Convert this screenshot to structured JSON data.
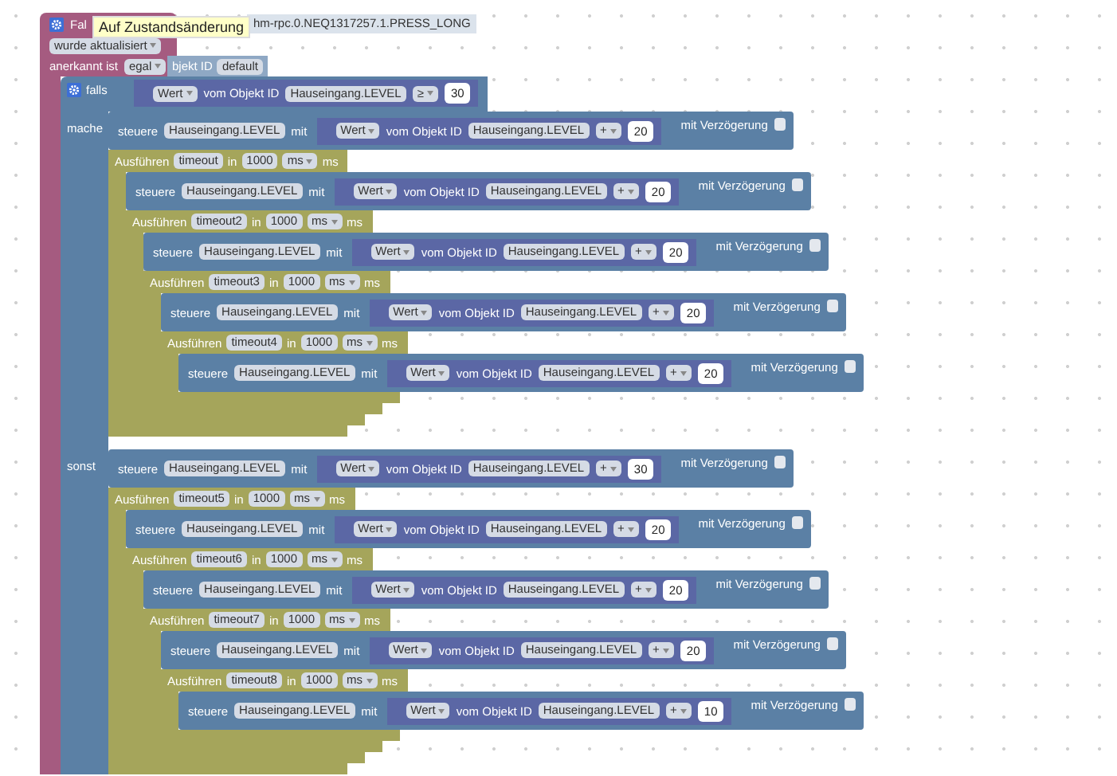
{
  "trigger": {
    "title": "Fal",
    "tooltip": "Auf Zustandsänderung",
    "object_id": "hm-rpc.0.NEQ1317257.1.PRESS_LONG",
    "mode": "wurde aktualisiert",
    "ack_label": "anerkannt ist",
    "ack_value": "egal",
    "object_label": "bjekt ID",
    "object_value": "default"
  },
  "if_block": {
    "if_label": "falls",
    "condition": {
      "select": "Wert",
      "of_label": "vom Objekt ID",
      "object_id": "Hauseingang.LEVEL",
      "operator": "≥",
      "number": "30"
    },
    "then_label": "mache",
    "then": [
      {
        "kind": "set",
        "verb": "steuere",
        "target": "Hauseingang.LEVEL",
        "with": "mit",
        "value": {
          "select": "Wert",
          "of_label": "vom Objekt ID",
          "object_id": "Hauseingang.LEVEL",
          "operator": "+",
          "number": "20"
        },
        "delay_label": "mit Verzögerung",
        "delay": false
      },
      {
        "kind": "timeout",
        "label": "Ausführen",
        "name": "timeout",
        "in": "in",
        "duration": "1000",
        "unit": "ms",
        "suffix": "ms",
        "children": [
          {
            "kind": "set",
            "verb": "steuere",
            "target": "Hauseingang.LEVEL",
            "with": "mit",
            "value": {
              "select": "Wert",
              "of_label": "vom Objekt ID",
              "object_id": "Hauseingang.LEVEL",
              "operator": "+",
              "number": "20"
            },
            "delay_label": "mit Verzögerung",
            "delay": false
          },
          {
            "kind": "timeout",
            "label": "Ausführen",
            "name": "timeout2",
            "in": "in",
            "duration": "1000",
            "unit": "ms",
            "suffix": "ms",
            "children": [
              {
                "kind": "set",
                "verb": "steuere",
                "target": "Hauseingang.LEVEL",
                "with": "mit",
                "value": {
                  "select": "Wert",
                  "of_label": "vom Objekt ID",
                  "object_id": "Hauseingang.LEVEL",
                  "operator": "+",
                  "number": "20"
                },
                "delay_label": "mit Verzögerung",
                "delay": false
              },
              {
                "kind": "timeout",
                "label": "Ausführen",
                "name": "timeout3",
                "in": "in",
                "duration": "1000",
                "unit": "ms",
                "suffix": "ms",
                "children": [
                  {
                    "kind": "set",
                    "verb": "steuere",
                    "target": "Hauseingang.LEVEL",
                    "with": "mit",
                    "value": {
                      "select": "Wert",
                      "of_label": "vom Objekt ID",
                      "object_id": "Hauseingang.LEVEL",
                      "operator": "+",
                      "number": "20"
                    },
                    "delay_label": "mit Verzögerung",
                    "delay": false
                  },
                  {
                    "kind": "timeout",
                    "label": "Ausführen",
                    "name": "timeout4",
                    "in": "in",
                    "duration": "1000",
                    "unit": "ms",
                    "suffix": "ms",
                    "children": [
                      {
                        "kind": "set",
                        "verb": "steuere",
                        "target": "Hauseingang.LEVEL",
                        "with": "mit",
                        "value": {
                          "select": "Wert",
                          "of_label": "vom Objekt ID",
                          "object_id": "Hauseingang.LEVEL",
                          "operator": "+",
                          "number": "20"
                        },
                        "delay_label": "mit Verzögerung",
                        "delay": false
                      }
                    ]
                  }
                ]
              }
            ]
          }
        ]
      }
    ],
    "else_label": "sonst",
    "else": [
      {
        "kind": "set",
        "verb": "steuere",
        "target": "Hauseingang.LEVEL",
        "with": "mit",
        "value": {
          "select": "Wert",
          "of_label": "vom Objekt ID",
          "object_id": "Hauseingang.LEVEL",
          "operator": "+",
          "number": "30"
        },
        "delay_label": "mit Verzögerung",
        "delay": false
      },
      {
        "kind": "timeout",
        "label": "Ausführen",
        "name": "timeout5",
        "in": "in",
        "duration": "1000",
        "unit": "ms",
        "suffix": "ms",
        "children": [
          {
            "kind": "set",
            "verb": "steuere",
            "target": "Hauseingang.LEVEL",
            "with": "mit",
            "value": {
              "select": "Wert",
              "of_label": "vom Objekt ID",
              "object_id": "Hauseingang.LEVEL",
              "operator": "+",
              "number": "20"
            },
            "delay_label": "mit Verzögerung",
            "delay": false
          },
          {
            "kind": "timeout",
            "label": "Ausführen",
            "name": "timeout6",
            "in": "in",
            "duration": "1000",
            "unit": "ms",
            "suffix": "ms",
            "children": [
              {
                "kind": "set",
                "verb": "steuere",
                "target": "Hauseingang.LEVEL",
                "with": "mit",
                "value": {
                  "select": "Wert",
                  "of_label": "vom Objekt ID",
                  "object_id": "Hauseingang.LEVEL",
                  "operator": "+",
                  "number": "20"
                },
                "delay_label": "mit Verzögerung",
                "delay": false
              },
              {
                "kind": "timeout",
                "label": "Ausführen",
                "name": "timeout7",
                "in": "in",
                "duration": "1000",
                "unit": "ms",
                "suffix": "ms",
                "children": [
                  {
                    "kind": "set",
                    "verb": "steuere",
                    "target": "Hauseingang.LEVEL",
                    "with": "mit",
                    "value": {
                      "select": "Wert",
                      "of_label": "vom Objekt ID",
                      "object_id": "Hauseingang.LEVEL",
                      "operator": "+",
                      "number": "20"
                    },
                    "delay_label": "mit Verzögerung",
                    "delay": false
                  },
                  {
                    "kind": "timeout",
                    "label": "Ausführen",
                    "name": "timeout8",
                    "in": "in",
                    "duration": "1000",
                    "unit": "ms",
                    "suffix": "ms",
                    "children": [
                      {
                        "kind": "set",
                        "verb": "steuere",
                        "target": "Hauseingang.LEVEL",
                        "with": "mit",
                        "value": {
                          "select": "Wert",
                          "of_label": "vom Objekt ID",
                          "object_id": "Hauseingang.LEVEL",
                          "operator": "+",
                          "number": "10"
                        },
                        "delay_label": "mit Verzögerung",
                        "delay": false
                      }
                    ]
                  }
                ]
              }
            ]
          }
        ]
      }
    ]
  }
}
